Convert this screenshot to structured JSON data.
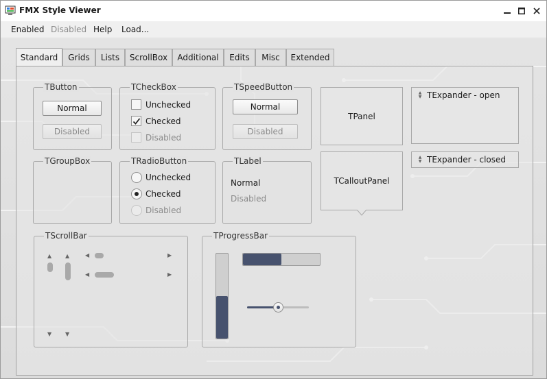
{
  "window": {
    "title": "FMX Style Viewer"
  },
  "menu": {
    "items": [
      {
        "label": "Enabled",
        "disabled": false
      },
      {
        "label": "Disabled",
        "disabled": true
      },
      {
        "label": "Help",
        "disabled": false
      },
      {
        "label": "Load...",
        "disabled": false
      }
    ]
  },
  "tabs": [
    {
      "label": "Standard",
      "active": true
    },
    {
      "label": "Grids"
    },
    {
      "label": "Lists"
    },
    {
      "label": "ScrollBox"
    },
    {
      "label": "Additional"
    },
    {
      "label": "Edits"
    },
    {
      "label": "Misc"
    },
    {
      "label": "Extended"
    }
  ],
  "standard": {
    "tbutton": {
      "caption": "TButton",
      "normal": "Normal",
      "disabled": "Disabled"
    },
    "tcheckbox": {
      "caption": "TCheckBox",
      "unchecked": "Unchecked",
      "checked": "Checked",
      "disabled": "Disabled"
    },
    "tspeedbutton": {
      "caption": "TSpeedButton",
      "normal": "Normal",
      "disabled": "Disabled"
    },
    "tgroupbox": {
      "caption": "TGroupBox"
    },
    "tradiobutton": {
      "caption": "TRadioButton",
      "unchecked": "Unchecked",
      "checked": "Checked",
      "disabled": "Disabled"
    },
    "tlabel": {
      "caption": "TLabel",
      "normal": "Normal",
      "disabled": "Disabled"
    },
    "tpanel": {
      "label": "TPanel"
    },
    "tcalloutpanel": {
      "label": "TCalloutPanel"
    },
    "texpander_open": {
      "label": "TExpander - open"
    },
    "texpander_closed": {
      "label": "TExpander - closed"
    },
    "tscrollbar": {
      "caption": "TScrollBar"
    },
    "tprogressbar": {
      "caption": "TProgressBar",
      "vertical_progress": 0.5,
      "horizontal_progress": 0.5,
      "trackbar_value": 0.5
    }
  },
  "colors": {
    "accent": "#47526e",
    "border": "#a8a8a8"
  }
}
